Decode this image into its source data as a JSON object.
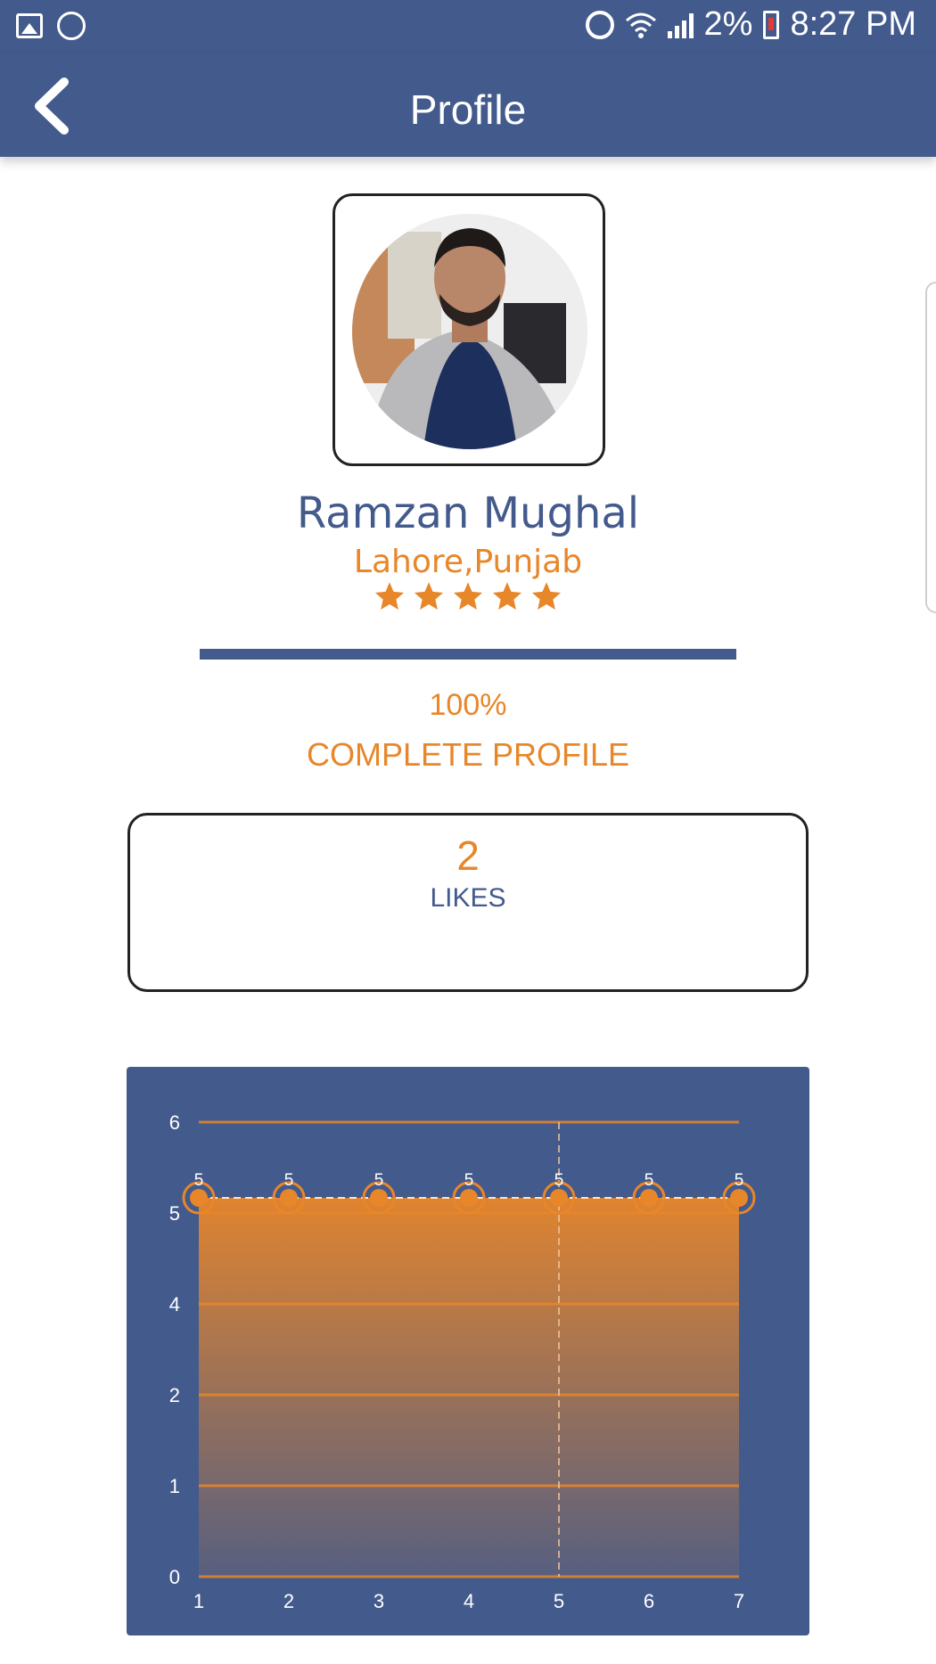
{
  "status_bar": {
    "battery": "2%",
    "time": "8:27 PM",
    "icons": [
      "gallery-icon",
      "whatsapp-icon",
      "alarm-icon",
      "wifi-icon",
      "signal-icon",
      "battery-icon"
    ]
  },
  "app_bar": {
    "title": "Profile",
    "back_icon": "chevron-left-icon"
  },
  "profile": {
    "name": "Ramzan Mughal",
    "location": "Lahore,Punjab",
    "rating": 5,
    "rating_max": 5,
    "completion_fraction": 1.0,
    "completion_percent": "100%",
    "completion_label": "COMPLETE PROFILE"
  },
  "likes": {
    "count": "2",
    "label": "LIKES"
  },
  "colors": {
    "primary": "#435a8c",
    "accent": "#e8862a",
    "background": "#ffffff"
  },
  "chart_data": {
    "type": "area",
    "x": [
      1,
      2,
      3,
      4,
      5,
      6,
      7
    ],
    "values": [
      5,
      5,
      5,
      5,
      5,
      5,
      5
    ],
    "data_labels": [
      "5",
      "5",
      "5",
      "5",
      "5",
      "5",
      "5"
    ],
    "y_ticks": [
      "0",
      "1",
      "2",
      "4",
      "5",
      "6"
    ],
    "x_ticks": [
      "1",
      "2",
      "3",
      "4",
      "5",
      "6",
      "7"
    ],
    "ylim": [
      0,
      6
    ],
    "highlight_x": 5,
    "grid": true,
    "title": "",
    "xlabel": "",
    "ylabel": ""
  }
}
